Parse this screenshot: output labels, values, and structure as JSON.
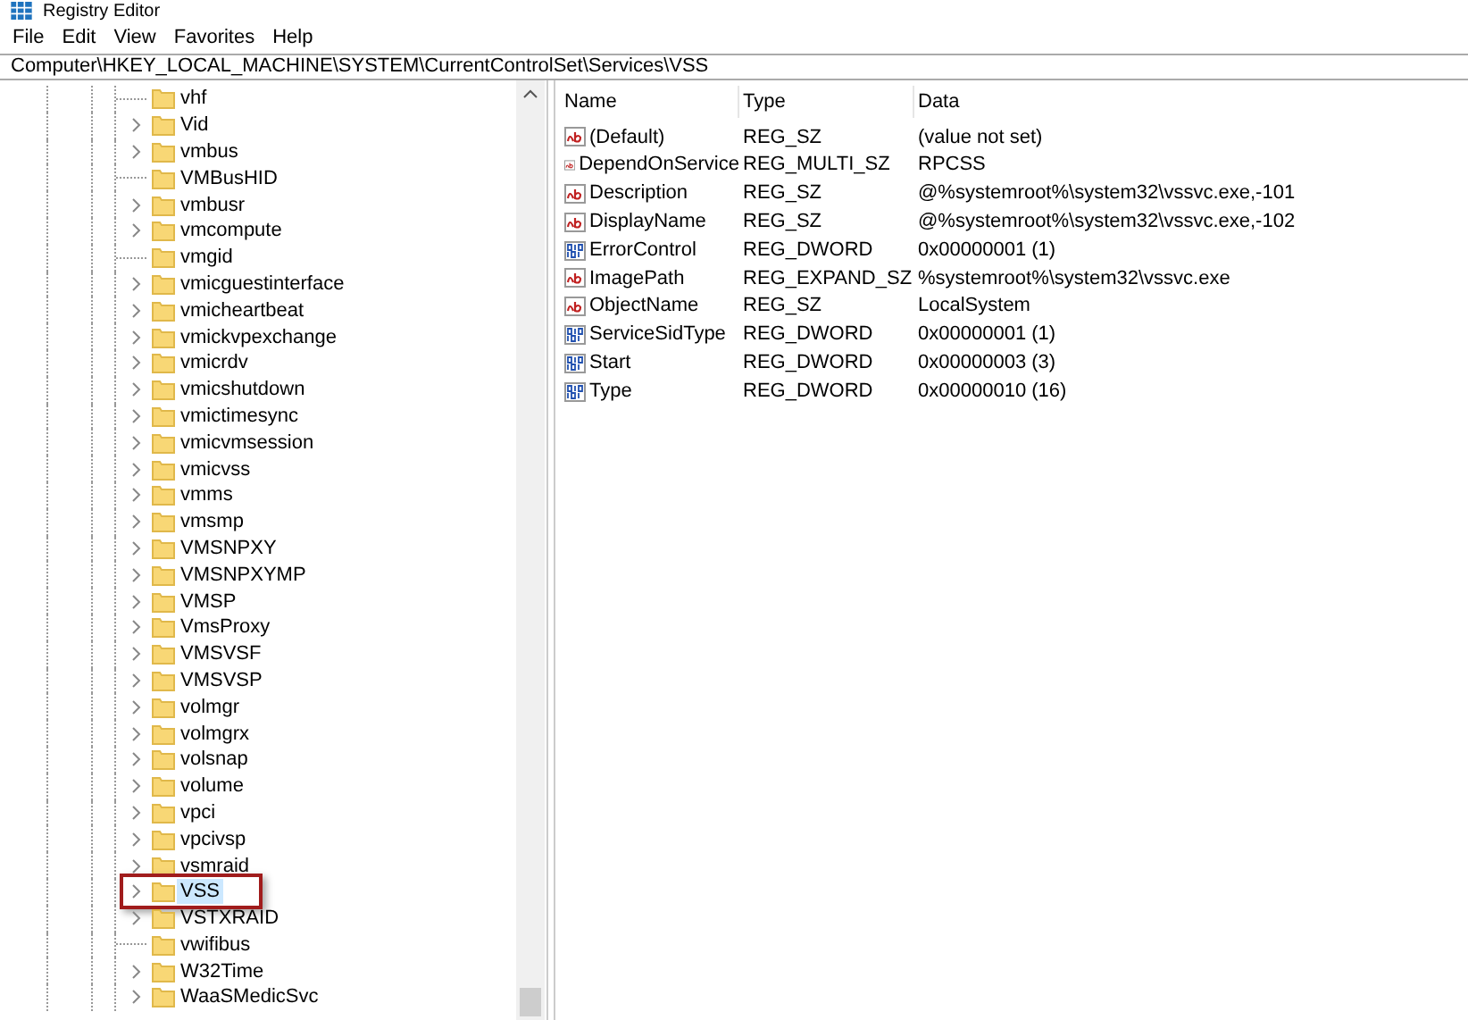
{
  "window": {
    "title": "Registry Editor"
  },
  "menu": [
    "File",
    "Edit",
    "View",
    "Favorites",
    "Help"
  ],
  "address": "Computer\\HKEY_LOCAL_MACHINE\\SYSTEM\\CurrentControlSet\\Services\\VSS",
  "tree": {
    "items": [
      {
        "label": "vhf",
        "expandable": false,
        "selected": false
      },
      {
        "label": "Vid",
        "expandable": true,
        "selected": false
      },
      {
        "label": "vmbus",
        "expandable": true,
        "selected": false
      },
      {
        "label": "VMBusHID",
        "expandable": false,
        "selected": false
      },
      {
        "label": "vmbusr",
        "expandable": true,
        "selected": false
      },
      {
        "label": "vmcompute",
        "expandable": true,
        "selected": false
      },
      {
        "label": "vmgid",
        "expandable": false,
        "selected": false
      },
      {
        "label": "vmicguestinterface",
        "expandable": true,
        "selected": false
      },
      {
        "label": "vmicheartbeat",
        "expandable": true,
        "selected": false
      },
      {
        "label": "vmickvpexchange",
        "expandable": true,
        "selected": false
      },
      {
        "label": "vmicrdv",
        "expandable": true,
        "selected": false
      },
      {
        "label": "vmicshutdown",
        "expandable": true,
        "selected": false
      },
      {
        "label": "vmictimesync",
        "expandable": true,
        "selected": false
      },
      {
        "label": "vmicvmsession",
        "expandable": true,
        "selected": false
      },
      {
        "label": "vmicvss",
        "expandable": true,
        "selected": false
      },
      {
        "label": "vmms",
        "expandable": true,
        "selected": false
      },
      {
        "label": "vmsmp",
        "expandable": true,
        "selected": false
      },
      {
        "label": "VMSNPXY",
        "expandable": true,
        "selected": false
      },
      {
        "label": "VMSNPXYMP",
        "expandable": true,
        "selected": false
      },
      {
        "label": "VMSP",
        "expandable": true,
        "selected": false
      },
      {
        "label": "VmsProxy",
        "expandable": true,
        "selected": false
      },
      {
        "label": "VMSVSF",
        "expandable": true,
        "selected": false
      },
      {
        "label": "VMSVSP",
        "expandable": true,
        "selected": false
      },
      {
        "label": "volmgr",
        "expandable": true,
        "selected": false
      },
      {
        "label": "volmgrx",
        "expandable": true,
        "selected": false
      },
      {
        "label": "volsnap",
        "expandable": true,
        "selected": false
      },
      {
        "label": "volume",
        "expandable": true,
        "selected": false
      },
      {
        "label": "vpci",
        "expandable": true,
        "selected": false
      },
      {
        "label": "vpcivsp",
        "expandable": true,
        "selected": false
      },
      {
        "label": "vsmraid",
        "expandable": true,
        "selected": false
      },
      {
        "label": "VSS",
        "expandable": true,
        "selected": true
      },
      {
        "label": "VSTXRAID",
        "expandable": true,
        "selected": false
      },
      {
        "label": "vwifibus",
        "expandable": false,
        "selected": false
      },
      {
        "label": "W32Time",
        "expandable": true,
        "selected": false
      },
      {
        "label": "WaaSMedicSvc",
        "expandable": true,
        "selected": false
      }
    ]
  },
  "values": {
    "columns": [
      "Name",
      "Type",
      "Data"
    ],
    "rows": [
      {
        "kind": "string",
        "name": "(Default)",
        "type": "REG_SZ",
        "data": "(value not set)"
      },
      {
        "kind": "string",
        "name": "DependOnService",
        "type": "REG_MULTI_SZ",
        "data": "RPCSS"
      },
      {
        "kind": "string",
        "name": "Description",
        "type": "REG_SZ",
        "data": "@%systemroot%\\system32\\vssvc.exe,-101"
      },
      {
        "kind": "string",
        "name": "DisplayName",
        "type": "REG_SZ",
        "data": "@%systemroot%\\system32\\vssvc.exe,-102"
      },
      {
        "kind": "binary",
        "name": "ErrorControl",
        "type": "REG_DWORD",
        "data": "0x00000001 (1)"
      },
      {
        "kind": "string",
        "name": "ImagePath",
        "type": "REG_EXPAND_SZ",
        "data": "%systemroot%\\system32\\vssvc.exe"
      },
      {
        "kind": "string",
        "name": "ObjectName",
        "type": "REG_SZ",
        "data": "LocalSystem"
      },
      {
        "kind": "binary",
        "name": "ServiceSidType",
        "type": "REG_DWORD",
        "data": "0x00000001 (1)"
      },
      {
        "kind": "binary",
        "name": "Start",
        "type": "REG_DWORD",
        "data": "0x00000003 (3)"
      },
      {
        "kind": "binary",
        "name": "Type",
        "type": "REG_DWORD",
        "data": "0x00000010 (16)"
      }
    ]
  }
}
